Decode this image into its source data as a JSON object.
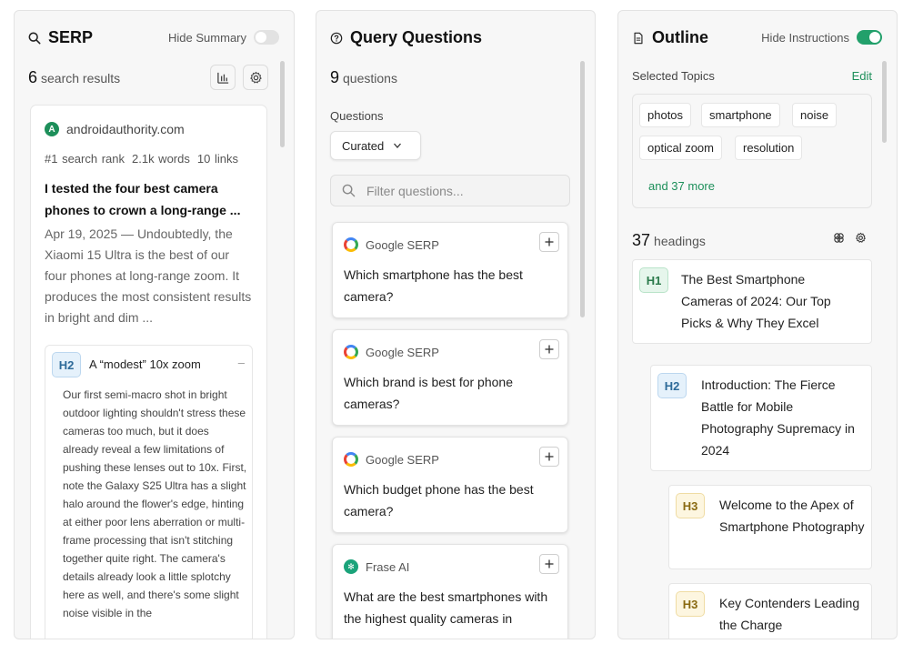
{
  "serp": {
    "title": "SERP",
    "toggle_label": "Hide Summary",
    "count": "6",
    "count_label": "search results",
    "result": {
      "domain": "androidauthority.com",
      "logo_letter": "A",
      "rank": "#1 search rank",
      "words": "2.1k words",
      "links": "10 links",
      "title": "I tested the four best camera phones to crown a long-range ...",
      "snippet": "Apr 19, 2025 — Undoubtedly, the Xiaomi 15 Ultra is the best of our four phones at long-range zoom. It produces the most consistent results in bright and dim ...",
      "heading": {
        "level": "H2",
        "title": "A “modest” 10x zoom",
        "collapse": "–",
        "body": "Our first semi-macro shot in bright outdoor lighting shouldn't stress these cameras too much, but it does already reveal a few limitations of pushing these lenses out to 10x. First, note the Galaxy S25 Ultra has a slight halo around the flower's edge, hinting at either poor lens aberration or multi-frame processing that isn't stitching together quite right. The camera's details already look a little splotchy here as well, and there's some slight noise visible in the"
      }
    }
  },
  "query": {
    "title": "Query Questions",
    "count": "9",
    "count_label": "questions",
    "questions_label": "Questions",
    "dropdown_value": "Curated",
    "filter_placeholder": "Filter questions...",
    "items": [
      {
        "source": "Google SERP",
        "text": "Which smartphone has the best camera?"
      },
      {
        "source": "Google SERP",
        "text": "Which brand is best for phone cameras?"
      },
      {
        "source": "Google SERP",
        "text": "Which budget phone has the best camera?"
      },
      {
        "source": "Frase AI",
        "text": "What are the best smartphones with the highest quality cameras in"
      }
    ]
  },
  "outline": {
    "title": "Outline",
    "toggle_label": "Hide Instructions",
    "selected_topics_label": "Selected Topics",
    "edit_label": "Edit",
    "topics": [
      "photos",
      "smartphone",
      "noise",
      "optical zoom",
      "resolution"
    ],
    "more_label": "and 37 more",
    "count": "37",
    "count_label": "headings",
    "headings": [
      {
        "level": "H1",
        "text": "The Best Smartphone Cameras of 2024: Our Top Picks & Why They Excel"
      },
      {
        "level": "H2",
        "text": "Introduction: The Fierce Battle for Mobile Photography Supremacy in 2024"
      },
      {
        "level": "H3",
        "text": "Welcome to the Apex of Smartphone Photography"
      },
      {
        "level": "H3",
        "text": "Key Contenders Leading the Charge"
      }
    ]
  },
  "colors": {
    "accent_green": "#1d8f5a",
    "toggle_on": "#22a06b"
  }
}
